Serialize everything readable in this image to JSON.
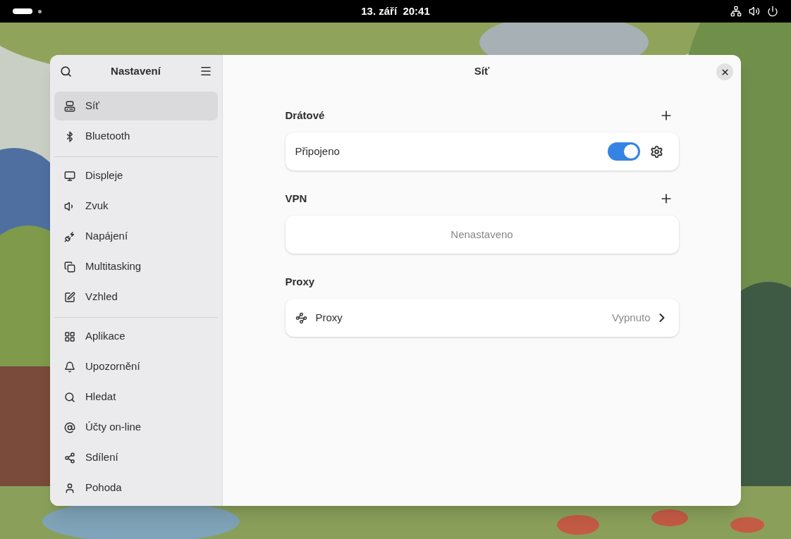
{
  "top_bar": {
    "clock": "13. září  20:41"
  },
  "sidebar": {
    "title": "Nastavení",
    "groups": [
      [
        {
          "label": "Síť",
          "selected": true
        },
        {
          "label": "Bluetooth",
          "selected": false
        }
      ],
      [
        {
          "label": "Displeje",
          "selected": false
        },
        {
          "label": "Zvuk",
          "selected": false
        },
        {
          "label": "Napájení",
          "selected": false
        },
        {
          "label": "Multitasking",
          "selected": false
        },
        {
          "label": "Vzhled",
          "selected": false
        }
      ],
      [
        {
          "label": "Aplikace",
          "selected": false
        },
        {
          "label": "Upozornění",
          "selected": false
        },
        {
          "label": "Hledat",
          "selected": false
        },
        {
          "label": "Účty on-line",
          "selected": false
        },
        {
          "label": "Sdílení",
          "selected": false
        },
        {
          "label": "Pohoda",
          "selected": false
        }
      ]
    ]
  },
  "main": {
    "title": "Síť",
    "sections": [
      {
        "title": "Drátové",
        "add_button": true,
        "rows": [
          {
            "kind": "toggle",
            "label": "Připojeno",
            "on": true
          }
        ]
      },
      {
        "title": "VPN",
        "add_button": true,
        "rows": [
          {
            "kind": "empty",
            "label": "Nenastaveno"
          }
        ]
      },
      {
        "title": "Proxy",
        "add_button": false,
        "rows": [
          {
            "kind": "link",
            "label": "Proxy",
            "value": "Vypnuto"
          }
        ]
      }
    ]
  }
}
